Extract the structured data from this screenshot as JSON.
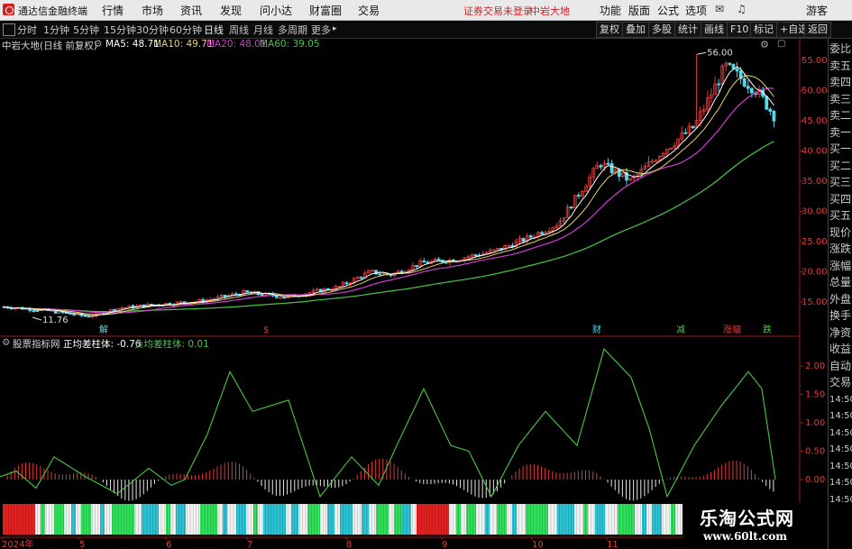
{
  "titlebar": {
    "app_name": "通达信金融终端",
    "menus": [
      "行情",
      "市场",
      "资讯",
      "发现",
      "问小达",
      "财富圈",
      "交易"
    ],
    "login_status": "证券交易未登录",
    "stock_name": "中岩大地",
    "right_menus": [
      "功能",
      "版面",
      "公式",
      "选项"
    ],
    "guest": "游客"
  },
  "toolbar": {
    "periods": [
      "分时",
      "1分钟",
      "5分钟",
      "15分钟",
      "30分钟",
      "60分钟",
      "日线",
      "周线",
      "月线",
      "多周期",
      "更多"
    ],
    "active_period": "日线",
    "right_buttons": [
      "复权",
      "叠加",
      "多股",
      "统计",
      "画线",
      "F10",
      "标记",
      "+自选",
      "返回"
    ]
  },
  "main_chart": {
    "title": "中岩大地(日线 前复权)",
    "ma5": "MA5: 48.71",
    "ma10": "MA10: 49.71",
    "ma20": "MA20: 48.01",
    "ma60": "MA60: 39.05",
    "high_label": "56.00",
    "low_label": "11.76",
    "price_axis": [
      "55.00",
      "50.00",
      "45.00",
      "40.00",
      "35.00",
      "30.00",
      "25.00",
      "20.00",
      "15.00"
    ],
    "event_marks": [
      "解",
      "$",
      "财",
      "减",
      "涨幅",
      "跌"
    ]
  },
  "colors": {
    "up": "#e03b3b",
    "down": "#54d8ec",
    "ma5": "#ffffff",
    "ma10": "#e6d26a",
    "ma20": "#d23cd2",
    "ma60": "#46c846",
    "axis": "#a01818"
  },
  "sub_chart": {
    "title": "股票指标网",
    "pos_label": "正均差柱体: -0.76",
    "neg_label": "负均差柱体: 0.01",
    "axis": [
      "2.00",
      "1.50",
      "1.00",
      "0.50",
      "0.00"
    ]
  },
  "date_axis": [
    "2024年",
    "5",
    "6",
    "7",
    "8",
    "9",
    "10",
    "11"
  ],
  "side_panel": {
    "items": [
      "委比",
      "卖五",
      "卖四",
      "卖三",
      "卖二",
      "卖一",
      "买一",
      "买二",
      "买三",
      "买四",
      "买五",
      "现价",
      "涨跌",
      "涨幅",
      "总量",
      "外盘",
      "换手",
      "净资",
      "收益",
      "自动",
      "交易",
      "14:50",
      "14:50",
      "14:50",
      "14:50",
      "14:50",
      "14:50",
      "14:50"
    ]
  },
  "watermark": {
    "title": "乐淘公式网",
    "url": "www.60lt.com"
  }
}
